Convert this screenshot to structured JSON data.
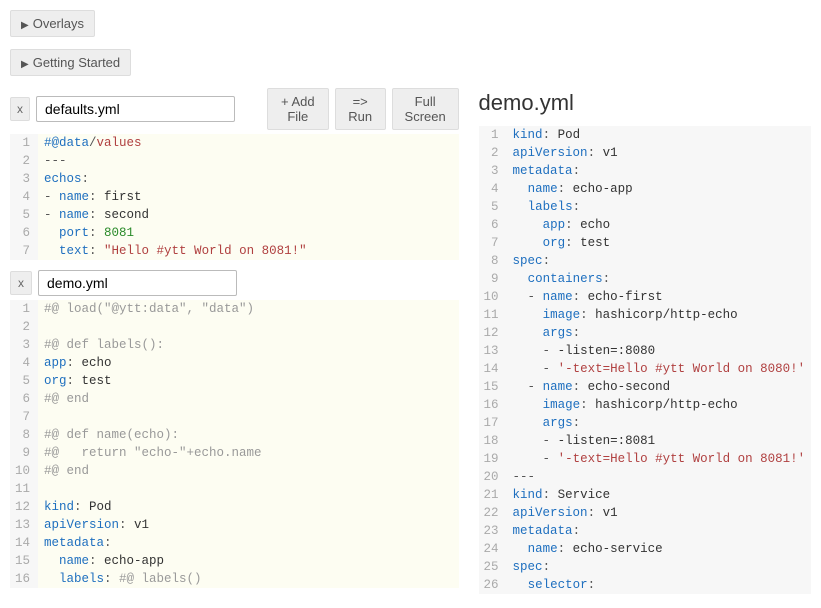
{
  "topButtons": {
    "overlays": "Overlays",
    "gettingStarted": "Getting Started"
  },
  "actions": {
    "addFile": "+ Add File",
    "run": "=> Run",
    "fullScreen": "Full Screen"
  },
  "closeLabel": "x",
  "files": [
    {
      "name": "defaults.yml",
      "lines": [
        [
          {
            "t": "#@data",
            "c": "c-key"
          },
          {
            "t": "/",
            "c": "c-punc"
          },
          {
            "t": "values",
            "c": "c-path"
          }
        ],
        [
          {
            "t": "---",
            "c": "c-punc"
          }
        ],
        [
          {
            "t": "echos",
            "c": "c-key"
          },
          {
            "t": ":",
            "c": "c-punc"
          }
        ],
        [
          {
            "t": "- ",
            "c": "c-punc"
          },
          {
            "t": "name",
            "c": "c-key"
          },
          {
            "t": ": ",
            "c": "c-punc"
          },
          {
            "t": "first",
            "c": "c-val"
          }
        ],
        [
          {
            "t": "- ",
            "c": "c-punc"
          },
          {
            "t": "name",
            "c": "c-key"
          },
          {
            "t": ": ",
            "c": "c-punc"
          },
          {
            "t": "second",
            "c": "c-val"
          }
        ],
        [
          {
            "t": "  ",
            "c": ""
          },
          {
            "t": "port",
            "c": "c-key"
          },
          {
            "t": ": ",
            "c": "c-punc"
          },
          {
            "t": "8081",
            "c": "c-num"
          }
        ],
        [
          {
            "t": "  ",
            "c": ""
          },
          {
            "t": "text",
            "c": "c-key"
          },
          {
            "t": ": ",
            "c": "c-punc"
          },
          {
            "t": "\"Hello #ytt World on 8081!\"",
            "c": "c-str"
          }
        ]
      ]
    },
    {
      "name": "demo.yml",
      "lines": [
        [
          {
            "t": "#@ load(\"@ytt:data\", \"data\")",
            "c": "c-comment"
          }
        ],
        [
          {
            "t": "",
            "c": ""
          }
        ],
        [
          {
            "t": "#@ def labels():",
            "c": "c-comment"
          }
        ],
        [
          {
            "t": "app",
            "c": "c-key"
          },
          {
            "t": ": ",
            "c": "c-punc"
          },
          {
            "t": "echo",
            "c": "c-val"
          }
        ],
        [
          {
            "t": "org",
            "c": "c-key"
          },
          {
            "t": ": ",
            "c": "c-punc"
          },
          {
            "t": "test",
            "c": "c-val"
          }
        ],
        [
          {
            "t": "#@ end",
            "c": "c-comment"
          }
        ],
        [
          {
            "t": "",
            "c": ""
          }
        ],
        [
          {
            "t": "#@ def name(echo):",
            "c": "c-comment"
          }
        ],
        [
          {
            "t": "#@   return \"echo-\"+echo.name",
            "c": "c-comment"
          }
        ],
        [
          {
            "t": "#@ end",
            "c": "c-comment"
          }
        ],
        [
          {
            "t": "",
            "c": ""
          }
        ],
        [
          {
            "t": "kind",
            "c": "c-key"
          },
          {
            "t": ": ",
            "c": "c-punc"
          },
          {
            "t": "Pod",
            "c": "c-val"
          }
        ],
        [
          {
            "t": "apiVersion",
            "c": "c-key"
          },
          {
            "t": ": ",
            "c": "c-punc"
          },
          {
            "t": "v1",
            "c": "c-val"
          }
        ],
        [
          {
            "t": "metadata",
            "c": "c-key"
          },
          {
            "t": ":",
            "c": "c-punc"
          }
        ],
        [
          {
            "t": "  ",
            "c": ""
          },
          {
            "t": "name",
            "c": "c-key"
          },
          {
            "t": ": ",
            "c": "c-punc"
          },
          {
            "t": "echo-app",
            "c": "c-val"
          }
        ],
        [
          {
            "t": "  ",
            "c": ""
          },
          {
            "t": "labels",
            "c": "c-key"
          },
          {
            "t": ": ",
            "c": "c-punc"
          },
          {
            "t": "#@ labels()",
            "c": "c-comment"
          }
        ]
      ]
    }
  ],
  "output": {
    "title": "demo.yml",
    "lines": [
      [
        {
          "t": "kind",
          "c": "c-key"
        },
        {
          "t": ": ",
          "c": "c-punc"
        },
        {
          "t": "Pod",
          "c": "c-val"
        }
      ],
      [
        {
          "t": "apiVersion",
          "c": "c-key"
        },
        {
          "t": ": ",
          "c": "c-punc"
        },
        {
          "t": "v1",
          "c": "c-val"
        }
      ],
      [
        {
          "t": "metadata",
          "c": "c-key"
        },
        {
          "t": ":",
          "c": "c-punc"
        }
      ],
      [
        {
          "t": "  ",
          "c": ""
        },
        {
          "t": "name",
          "c": "c-key"
        },
        {
          "t": ": ",
          "c": "c-punc"
        },
        {
          "t": "echo-app",
          "c": "c-val"
        }
      ],
      [
        {
          "t": "  ",
          "c": ""
        },
        {
          "t": "labels",
          "c": "c-key"
        },
        {
          "t": ":",
          "c": "c-punc"
        }
      ],
      [
        {
          "t": "    ",
          "c": ""
        },
        {
          "t": "app",
          "c": "c-key"
        },
        {
          "t": ": ",
          "c": "c-punc"
        },
        {
          "t": "echo",
          "c": "c-val"
        }
      ],
      [
        {
          "t": "    ",
          "c": ""
        },
        {
          "t": "org",
          "c": "c-key"
        },
        {
          "t": ": ",
          "c": "c-punc"
        },
        {
          "t": "test",
          "c": "c-val"
        }
      ],
      [
        {
          "t": "spec",
          "c": "c-key"
        },
        {
          "t": ":",
          "c": "c-punc"
        }
      ],
      [
        {
          "t": "  ",
          "c": ""
        },
        {
          "t": "containers",
          "c": "c-key"
        },
        {
          "t": ":",
          "c": "c-punc"
        }
      ],
      [
        {
          "t": "  - ",
          "c": "c-punc"
        },
        {
          "t": "name",
          "c": "c-key"
        },
        {
          "t": ": ",
          "c": "c-punc"
        },
        {
          "t": "echo-first",
          "c": "c-val"
        }
      ],
      [
        {
          "t": "    ",
          "c": ""
        },
        {
          "t": "image",
          "c": "c-key"
        },
        {
          "t": ": ",
          "c": "c-punc"
        },
        {
          "t": "hashicorp/http-echo",
          "c": "c-val"
        }
      ],
      [
        {
          "t": "    ",
          "c": ""
        },
        {
          "t": "args",
          "c": "c-key"
        },
        {
          "t": ":",
          "c": "c-punc"
        }
      ],
      [
        {
          "t": "    - ",
          "c": "c-punc"
        },
        {
          "t": "-listen=:8080",
          "c": "c-val"
        }
      ],
      [
        {
          "t": "    - ",
          "c": "c-punc"
        },
        {
          "t": "'-text=Hello #ytt World on 8080!'",
          "c": "c-str"
        }
      ],
      [
        {
          "t": "  - ",
          "c": "c-punc"
        },
        {
          "t": "name",
          "c": "c-key"
        },
        {
          "t": ": ",
          "c": "c-punc"
        },
        {
          "t": "echo-second",
          "c": "c-val"
        }
      ],
      [
        {
          "t": "    ",
          "c": ""
        },
        {
          "t": "image",
          "c": "c-key"
        },
        {
          "t": ": ",
          "c": "c-punc"
        },
        {
          "t": "hashicorp/http-echo",
          "c": "c-val"
        }
      ],
      [
        {
          "t": "    ",
          "c": ""
        },
        {
          "t": "args",
          "c": "c-key"
        },
        {
          "t": ":",
          "c": "c-punc"
        }
      ],
      [
        {
          "t": "    - ",
          "c": "c-punc"
        },
        {
          "t": "-listen=:8081",
          "c": "c-val"
        }
      ],
      [
        {
          "t": "    - ",
          "c": "c-punc"
        },
        {
          "t": "'-text=Hello #ytt World on 8081!'",
          "c": "c-str"
        }
      ],
      [
        {
          "t": "---",
          "c": "c-punc"
        }
      ],
      [
        {
          "t": "kind",
          "c": "c-key"
        },
        {
          "t": ": ",
          "c": "c-punc"
        },
        {
          "t": "Service",
          "c": "c-val"
        }
      ],
      [
        {
          "t": "apiVersion",
          "c": "c-key"
        },
        {
          "t": ": ",
          "c": "c-punc"
        },
        {
          "t": "v1",
          "c": "c-val"
        }
      ],
      [
        {
          "t": "metadata",
          "c": "c-key"
        },
        {
          "t": ":",
          "c": "c-punc"
        }
      ],
      [
        {
          "t": "  ",
          "c": ""
        },
        {
          "t": "name",
          "c": "c-key"
        },
        {
          "t": ": ",
          "c": "c-punc"
        },
        {
          "t": "echo-service",
          "c": "c-val"
        }
      ],
      [
        {
          "t": "spec",
          "c": "c-key"
        },
        {
          "t": ":",
          "c": "c-punc"
        }
      ],
      [
        {
          "t": "  ",
          "c": ""
        },
        {
          "t": "selector",
          "c": "c-key"
        },
        {
          "t": ":",
          "c": "c-punc"
        }
      ]
    ]
  }
}
